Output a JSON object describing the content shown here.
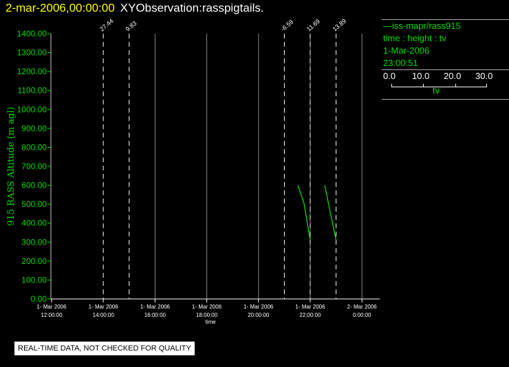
{
  "header": {
    "date": "2-mar-2006,00:00:00",
    "title": "XYObservation:rasspigtails."
  },
  "legend": {
    "series": "iss-mapr/rass915",
    "fields": "time : height : tv",
    "date": "1-Mar-2006",
    "time": "23:00:51",
    "scale_ticks": [
      "0.0",
      "10.0",
      "20.0",
      "30.0"
    ],
    "scale_label": "tv"
  },
  "note": "REAL-TIME DATA, NOT CHECKED FOR QUALITY",
  "colors": {
    "series": "#00dd00",
    "axis_labels": "#00dd00",
    "grid": "#888888",
    "dashed": "#ffffff"
  },
  "chart_data": {
    "type": "line",
    "ylabel": "915 RASS Altitude (m agl)",
    "xlabel": "time",
    "ylim": [
      0,
      1400
    ],
    "xlim_hours": [
      12,
      24
    ],
    "yticks": [
      "0.00",
      "100.00",
      "200.00",
      "300.00",
      "400.00",
      "500.00",
      "600.00",
      "700.00",
      "800.00",
      "900.00",
      "1000.00",
      "1100.00",
      "1200.00",
      "1300.00",
      "1400.00"
    ],
    "xticks": [
      {
        "h": 12,
        "l1": "1- Mar 2006",
        "l2": "12:00:00"
      },
      {
        "h": 14,
        "l1": "1- Mar 2006",
        "l2": "14:00:00"
      },
      {
        "h": 16,
        "l1": "1- Mar 2006",
        "l2": "16:00:00"
      },
      {
        "h": 18,
        "l1": "1- Mar 2006",
        "l2": "18:00:00"
      },
      {
        "h": 20,
        "l1": "1- Mar 2006",
        "l2": "20:00:00"
      },
      {
        "h": 22,
        "l1": "1- Mar 2006",
        "l2": "22:00:00"
      },
      {
        "h": 24,
        "l1": "2- Mar 2006",
        "l2": "0:00:00"
      }
    ],
    "grid_hours": [
      16,
      18,
      20,
      22,
      24
    ],
    "dashed_lines": [
      {
        "h": 14,
        "label": "27.44"
      },
      {
        "h": 15,
        "label": "9.83"
      },
      {
        "h": 21,
        "label": "-6.59"
      },
      {
        "h": 22,
        "label": "11.69"
      },
      {
        "h": 23,
        "label": "13.89"
      }
    ],
    "profiles": [
      {
        "points": [
          [
            21.52,
            600
          ],
          [
            21.76,
            505
          ],
          [
            22.0,
            310
          ]
        ]
      },
      {
        "points": [
          [
            22.56,
            600
          ],
          [
            23.0,
            310
          ]
        ]
      }
    ]
  }
}
